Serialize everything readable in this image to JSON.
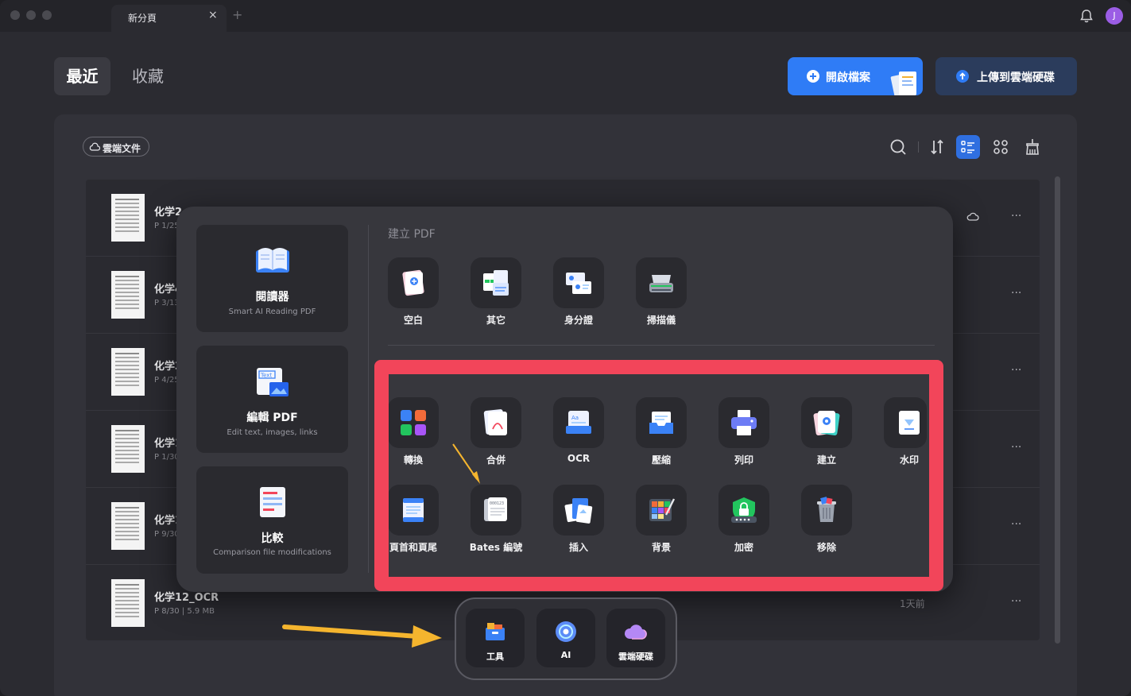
{
  "titlebar": {
    "tab_title": "新分頁",
    "close_glyph": "×",
    "add_glyph": "+",
    "avatar_initial": "J"
  },
  "nav": {
    "recent": "最近",
    "favorites": "收藏"
  },
  "actions": {
    "open_file": "開啟檔案",
    "upload_cloud": "上傳到雲端硬碟"
  },
  "filter": {
    "cloud_docs": "雲端文件"
  },
  "files": [
    {
      "title": "化学2",
      "meta": "P 1/25"
    },
    {
      "title": "化学4",
      "meta": "P 3/13"
    },
    {
      "title": "化学3",
      "meta": "P 4/25"
    },
    {
      "title": "化学1",
      "meta": "P 1/30"
    },
    {
      "title": "化学1",
      "meta": "P 9/30"
    },
    {
      "title": "化学12_OCR",
      "meta": "P 8/30  |  5.9 MB",
      "time": "1天前"
    }
  ],
  "row_more_glyph": "···",
  "popup": {
    "cards": [
      {
        "title": "閱讀器",
        "subtitle": "Smart AI Reading PDF"
      },
      {
        "title": "編輯 PDF",
        "subtitle": "Edit text, images, links"
      },
      {
        "title": "比較",
        "subtitle": "Comparison file modifications"
      }
    ],
    "create_section": "建立 PDF",
    "create_tools": [
      "空白",
      "其它",
      "身分證",
      "掃描儀"
    ],
    "tools_row1": [
      "轉換",
      "合併",
      "OCR",
      "壓縮",
      "列印",
      "建立",
      "水印"
    ],
    "tools_row2": [
      "頁首和頁尾",
      "Bates 編號",
      "插入",
      "背景",
      "加密",
      "移除"
    ]
  },
  "dock": {
    "tools": "工具",
    "ai": "AI",
    "cloud": "雲端硬碟"
  },
  "colors": {
    "accent": "#2f7cf6",
    "highlight": "#f2455a",
    "arrow": "#f5b52e"
  }
}
